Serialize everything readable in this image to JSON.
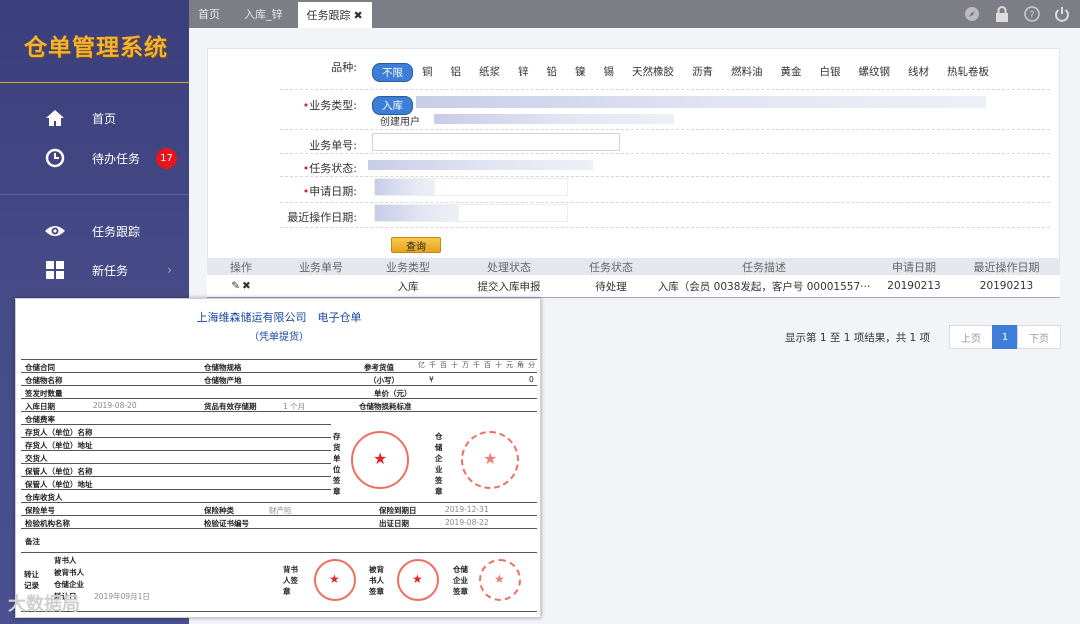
{
  "app": {
    "title": "仓单管理系统"
  },
  "sidebar": {
    "items": [
      {
        "label": "首页"
      },
      {
        "label": "待办任务",
        "badge": "17"
      },
      {
        "label": "任务跟踪"
      },
      {
        "label": "新任务"
      }
    ]
  },
  "tabs": [
    {
      "label": "首页"
    },
    {
      "label": "入库_锌"
    },
    {
      "label": "任务跟踪",
      "close": "✖"
    }
  ],
  "form": {
    "variety_label": "品种:",
    "varieties": [
      "不限",
      "铜",
      "铝",
      "纸浆",
      "锌",
      "铅",
      "镍",
      "锡",
      "天然橡胶",
      "沥青",
      "燃料油",
      "黄金",
      "白银",
      "螺纹钢",
      "线材",
      "热轧卷板"
    ],
    "biz_type_label": "业务类型:",
    "biz_type_selected": "入库",
    "created_label": "创建用户",
    "biz_no_label": "业务单号:",
    "task_status_label": "任务状态:",
    "apply_date_label": "申请日期:",
    "last_op_label": "最近操作日期:",
    "query_button": "查询",
    "required_mark": "•"
  },
  "table": {
    "headers": [
      "操作",
      "业务单号",
      "业务类型",
      "处理状态",
      "任务状态",
      "任务描述",
      "申请日期",
      "最近操作日期"
    ],
    "rows": [
      {
        "biz_type": "入库",
        "process_status": "提交入库申报",
        "task_status": "待处理",
        "desc": "入库（会员 0038发起，客户号 00001557···",
        "apply_date": "20190213",
        "last_op_date": "20190213"
      }
    ]
  },
  "pager": {
    "summary": "显示第 1 至 1 项结果，共 1 项",
    "prev": "上页",
    "current": "1",
    "next": "下页"
  },
  "document": {
    "company": "上海维森储运有限公司　电子仓单",
    "subtitle": "（凭单提货）",
    "labels": {
      "l1": "仓储合同",
      "l2": "仓储物名称",
      "l3": "签发时数量",
      "l4": "入库日期",
      "l5": "仓储费率",
      "l6": "存货人（单位）名称",
      "l7": "存货人（单位）地址",
      "l8": "交货人",
      "l9": "保管人（单位）名称",
      "l10": "保管人（单位）地址",
      "l11": "仓库收货人",
      "m1": "仓储物规格",
      "m2": "仓储物产地",
      "m4": "货品有效存储期",
      "r1": "参考货值",
      "r1b": "（小写）",
      "r3": "单价（元）",
      "r4": "仓储物损耗标准",
      "ins_no": "保险单号",
      "ins_type": "保险种类",
      "ins_due": "保险到期日",
      "org": "检验机构名称",
      "cert": "检验证书编号",
      "out_date": "出证日期",
      "note": "备注",
      "v4": "2019-08-20",
      "v4b": "1 个月",
      "v_ins_type": "财产险",
      "v_due": "2019-12-31",
      "v_out": "2019-08-22",
      "stamp1": "存货单位签章",
      "stamp2": "仓储企业签章",
      "tr": "转让记录",
      "e1": "背书人",
      "e2": "被背书人",
      "e3": "仓储企业",
      "e4": "转让日",
      "e4v": "年月日",
      "e4b": "2019年09月1日",
      "s1": "背书人签章",
      "s2": "被背书人签章",
      "s3": "仓储企业签章",
      "digits": [
        "亿",
        "千",
        "百",
        "十",
        "万",
        "千",
        "百",
        "十",
        "元",
        "角",
        "分"
      ],
      "yen": "¥",
      "zero": "0"
    }
  },
  "watermark": "大数据局",
  "colors": {
    "accent": "#3d7fd8",
    "sidebar": "#454a86",
    "logo": "#f2b233",
    "badge": "#e8141e",
    "doc_title": "#1a48a4",
    "stamp": "#e54"
  },
  "icons": [
    "home-icon",
    "clock-icon",
    "eye-icon",
    "grid-icon",
    "chevron-right-icon",
    "compass-icon",
    "lock-icon",
    "help-icon",
    "power-icon",
    "edit-icon",
    "delete-icon"
  ]
}
